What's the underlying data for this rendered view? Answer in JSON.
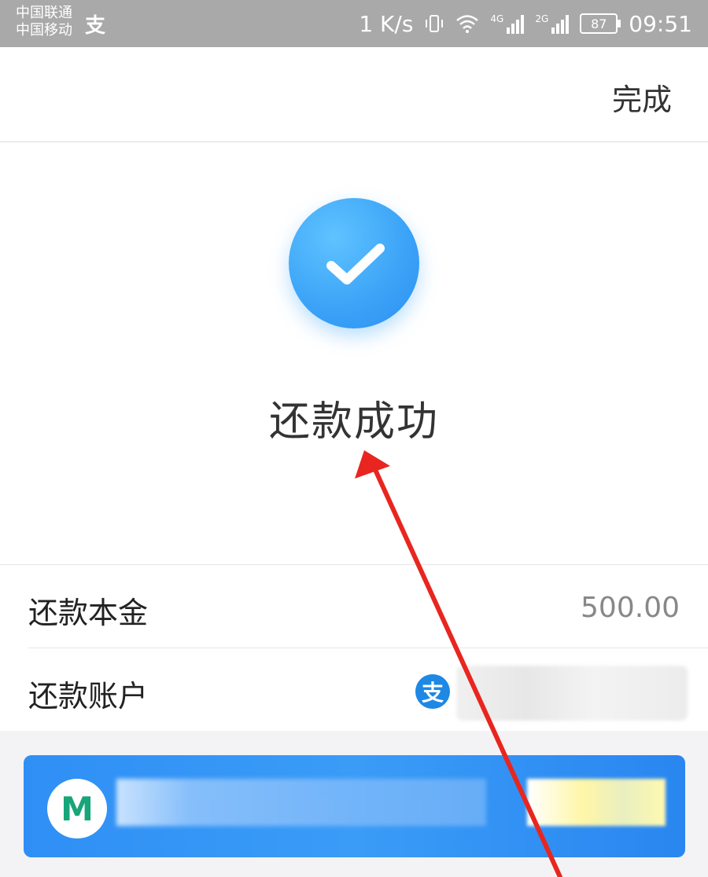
{
  "statusbar": {
    "carrier_1": "中国联通",
    "carrier_2": "中国移动",
    "alipay_glyph": "支",
    "network_speed": "1 K/s",
    "signal_1_label": "4G",
    "signal_2_label": "2G",
    "battery": "87",
    "time": "09:51"
  },
  "header": {
    "done_label": "完成"
  },
  "result": {
    "icon": "check-circle-icon",
    "title": "还款成功"
  },
  "details": {
    "principal_label": "还款本金",
    "principal_value": "500.00",
    "account_label": "还款账户",
    "account_icon_glyph": "支"
  },
  "banner": {
    "logo_glyph": "M"
  },
  "colors": {
    "accent_blue": "#3aa2f7",
    "arrow_red": "#e8261f",
    "statusbar_gray": "#a9a9a9"
  }
}
